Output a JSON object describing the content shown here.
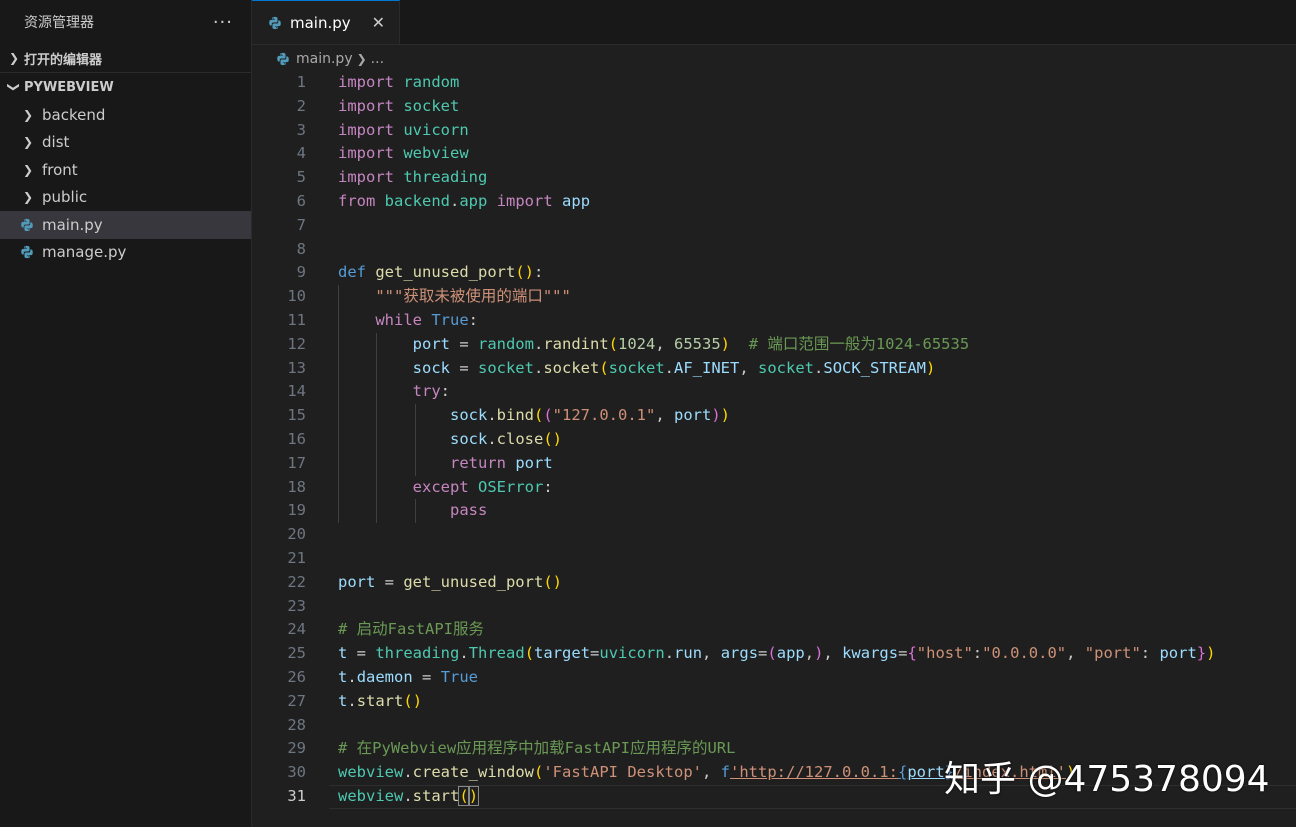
{
  "sidebar": {
    "title": "资源管理器",
    "more": "···",
    "open_editors": "打开的编辑器",
    "project": "PYWEBVIEW",
    "items": [
      {
        "label": "backend",
        "type": "folder"
      },
      {
        "label": "dist",
        "type": "folder"
      },
      {
        "label": "front",
        "type": "folder"
      },
      {
        "label": "public",
        "type": "folder"
      },
      {
        "label": "main.py",
        "type": "python",
        "active": true
      },
      {
        "label": "manage.py",
        "type": "python"
      }
    ]
  },
  "tab": {
    "label": "main.py",
    "close": "✕"
  },
  "breadcrumb": {
    "file": "main.py",
    "rest": "..."
  },
  "code": {
    "line_numbers": [
      "1",
      "2",
      "3",
      "4",
      "5",
      "6",
      "7",
      "8",
      "9",
      "10",
      "11",
      "12",
      "13",
      "14",
      "15",
      "16",
      "17",
      "18",
      "19",
      "20",
      "21",
      "22",
      "23",
      "24",
      "25",
      "26",
      "27",
      "28",
      "29",
      "30",
      "31"
    ],
    "current_line": 31,
    "tokens": {
      "import": "import",
      "from": "from",
      "def": "def",
      "while": "while",
      "try": "try",
      "return": "return",
      "except": "except",
      "pass": "pass",
      "true": "True",
      "random": "random",
      "socket": "socket",
      "uvicorn": "uvicorn",
      "webview": "webview",
      "threading": "threading",
      "backend": "backend",
      "app": "app",
      "get_unused_port": "get_unused_port",
      "docstring": "\"\"\"获取未被使用的端口\"\"\"",
      "port": "port",
      "randint": "randint",
      "n1024": "1024",
      "n65535": "65535",
      "comment12": "# 端口范围一般为1024-65535",
      "sock": "sock",
      "AF_INET": "AF_INET",
      "SOCK_STREAM": "SOCK_STREAM",
      "bind": "bind",
      "ip": "\"127.0.0.1\"",
      "close": "close",
      "OSError": "OSError",
      "comment24": "# 启动FastAPI服务",
      "t": "t",
      "Thread": "Thread",
      "target": "target",
      "run": "run",
      "args": "args",
      "kwargs": "kwargs",
      "host_key": "\"host\"",
      "host_val": "\"0.0.0.0\"",
      "port_key": "\"port\"",
      "daemon": "daemon",
      "start": "start",
      "comment29": "# 在PyWebview应用程序中加载FastAPI应用程序的URL",
      "create_window": "create_window",
      "title_str": "'FastAPI Desktop'",
      "f": "f",
      "url_str": "'http://127.0.0.1:",
      "url_var": "port",
      "url_rest": "/index.html'"
    }
  },
  "watermark": "知乎 @475378094",
  "colors": {
    "keyword": "#c586c0",
    "keyword_blue": "#569cd6",
    "function": "#dcdcaa",
    "variable": "#9cdcfe",
    "string": "#ce9178",
    "number": "#b5cea8",
    "comment": "#6a9955",
    "class": "#4ec9b0",
    "tab_accent": "#0078d4"
  }
}
